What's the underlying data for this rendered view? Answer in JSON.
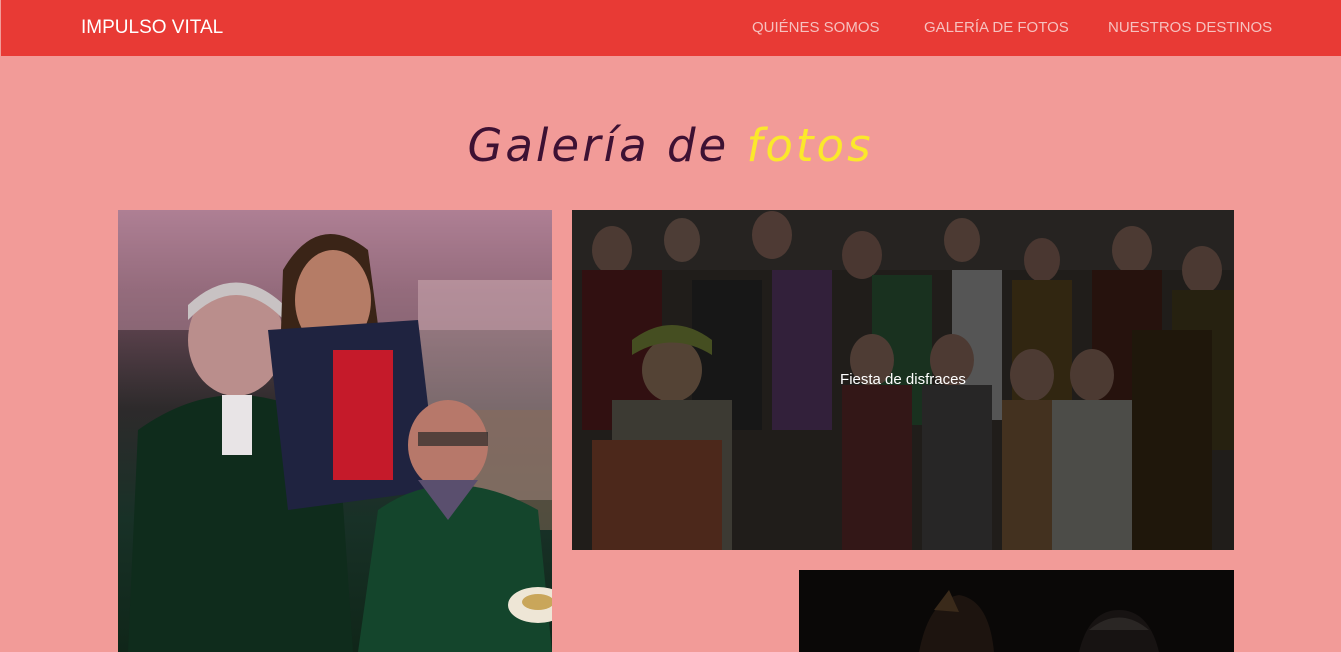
{
  "navbar": {
    "brand": "IMPULSO VITAL",
    "links": [
      {
        "label": "QUIÉNES SOMOS"
      },
      {
        "label": "GALERÍA DE FOTOS"
      },
      {
        "label": "NUESTROS DESTINOS"
      }
    ]
  },
  "gallery": {
    "title_part1": "Galería de ",
    "title_part2": "fotos",
    "photos": [
      {
        "caption": ""
      },
      {
        "caption": "Fiesta de disfraces"
      },
      {
        "caption": ""
      }
    ]
  },
  "colors": {
    "navbar": "#e83a35",
    "page_background": "#f29b98",
    "title": "#3d1133",
    "title_accent": "#fbe82b"
  }
}
